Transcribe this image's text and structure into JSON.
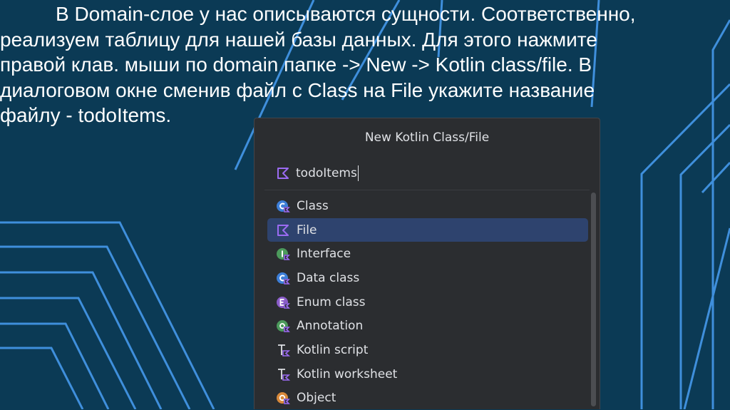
{
  "slide": {
    "text_lines": [
      "В Domain-слое у нас описываются сущности. Соответственно,",
      "реализуем таблицу для нашей базы данных. Для этого нажмите",
      "правой клав. мыши по domain папке -> New -> Kotlin class/file. В",
      "диалоговом окне сменив файл с Class на File укажите название",
      "файлу - todoItems."
    ]
  },
  "dialog": {
    "title": "New Kotlin Class/File",
    "name_value": "todoItems",
    "items": [
      {
        "label": "Class",
        "icon": "class-icon",
        "selected": false
      },
      {
        "label": "File",
        "icon": "kotlin-file-icon",
        "selected": true
      },
      {
        "label": "Interface",
        "icon": "interface-icon",
        "selected": false
      },
      {
        "label": "Data class",
        "icon": "data-class-icon",
        "selected": false
      },
      {
        "label": "Enum class",
        "icon": "enum-class-icon",
        "selected": false
      },
      {
        "label": "Annotation",
        "icon": "annotation-icon",
        "selected": false
      },
      {
        "label": "Kotlin script",
        "icon": "kotlin-script-icon",
        "selected": false
      },
      {
        "label": "Kotlin worksheet",
        "icon": "kotlin-worksheet-icon",
        "selected": false
      },
      {
        "label": "Object",
        "icon": "object-icon",
        "selected": false
      }
    ]
  },
  "colors": {
    "background": "#0b3a55",
    "decor_line": "#3f8fdc",
    "dialog_bg": "#2b2d30",
    "selection": "#2e436e",
    "kotlin_purple": "#9b6bf2"
  }
}
